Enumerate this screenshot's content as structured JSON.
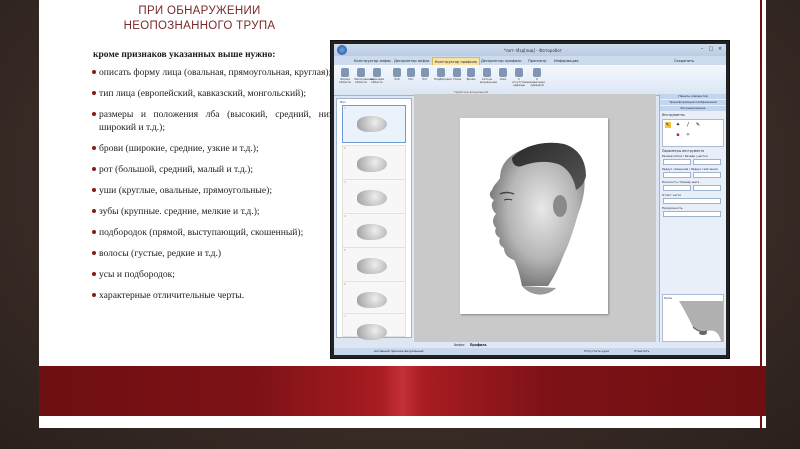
{
  "slide": {
    "title_line1": "ПРИ ОБНАРУЖЕНИИ",
    "title_line2": "НЕОПОЗНАННОГО ТРУПА",
    "lead": "кроме признаков указанных выше нужно:",
    "bullets": [
      "описать форму лица (овальная, прямоугольная, круглая);",
      "тип лица (европейский, кавказский, монгольский);",
      "размеры и положения лба (высокий, средний, низкий, широкий и т.д.);",
      "брови (широкие, средние, узкие и т.д.);",
      "рот (большой, средний, малый и т.д.);",
      "уши (круглые, овальные, прямоугольные);",
      "зубы (крупные. средние, мелкие и т.д.);",
      "подбородок (прямой, выступающий, скошенный);",
      "волосы (густые, редкие и т.д.)",
      "усы и подбородок;",
      "характерные отличительные черты."
    ],
    "accent_color": "#7a2a2a",
    "band_color": "#7d1216"
  },
  "app": {
    "window_title": "*лит- Изд[лид] - Фоторобот",
    "tabs": [
      "Конструктор анфас",
      "Дескриптор анфас",
      "Конструктор профиль",
      "Дескриптор профиль",
      "Просмотр",
      "Информация"
    ],
    "active_tab": "Конструктор профиль",
    "right_tab": "Сохранить",
    "ribbon_buttons": [
      "Форма области",
      "Запорленные области",
      "Черновая область",
      "Лоб",
      "Нос",
      "Рот",
      "Подбородок",
      "Глаза",
      "Брови",
      "Сеточн визуальная",
      "Оже",
      "С отсутствием одежды",
      "С надетыми одеждой"
    ],
    "ribbon_group": "Трубочки визуальной",
    "side_tabs": [
      "Панель элементов",
      "Трансформация изображения",
      "Ретуширование"
    ],
    "tools_label": "Инструменты",
    "params_label": "Параметры инструмента",
    "param_fields": [
      "Размер пятна",
      "Размер участка",
      "Радиус смешения",
      "Радиус смягчения",
      "Плотность",
      "Размер шага",
      "Прозрачность"
    ],
    "mode_label": "Отчет: части",
    "preview_label": "Лупа",
    "thumbnail_numbers": [
      "1",
      "2",
      "3",
      "4",
      "5",
      "6",
      "7"
    ],
    "thumb_header": "Нос",
    "bottom_tabs": [
      "Анфас",
      "Профиль"
    ],
    "status_left": "Активный признак визуальный",
    "status_right": [
      "Отпустить руки",
      "Отметить"
    ]
  }
}
